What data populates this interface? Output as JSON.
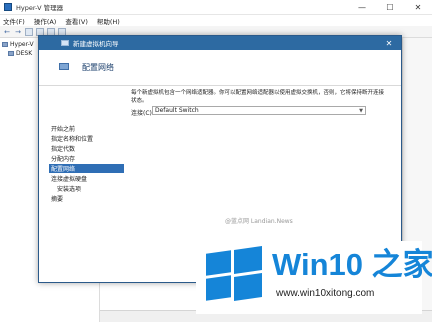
{
  "app": {
    "title": "Hyper-V 管理器",
    "controls": {
      "minimize": "—",
      "maximize": "☐",
      "close": "✕"
    }
  },
  "menu": [
    "文件(F)",
    "操作(A)",
    "查看(V)",
    "帮助(H)"
  ],
  "toolbar": {
    "back": "←",
    "forward": "→"
  },
  "tree": {
    "root": "Hyper-V",
    "child": "DESK"
  },
  "wizard": {
    "title": "新建虚拟机向导",
    "close": "✕",
    "page_title": "配置网络",
    "steps": [
      "开始之前",
      "指定名称和位置",
      "指定代数",
      "分配内存",
      "配置网络",
      "连接虚拟硬盘",
      "安装选项",
      "摘要"
    ],
    "active_step": 4,
    "description": "每个新虚拟机包含一个网络适配器。你可以配置网络适配器以使用虚拟交换机，否则，它将保持断开连接状态。",
    "connection_label": "连接(C):",
    "connection_value": "Default Switch",
    "watermark": "@蓝点网 Landian.News"
  },
  "brand": {
    "name": "Win10 之家",
    "url": "www.win10xitong.com",
    "color": "#1585d8"
  }
}
